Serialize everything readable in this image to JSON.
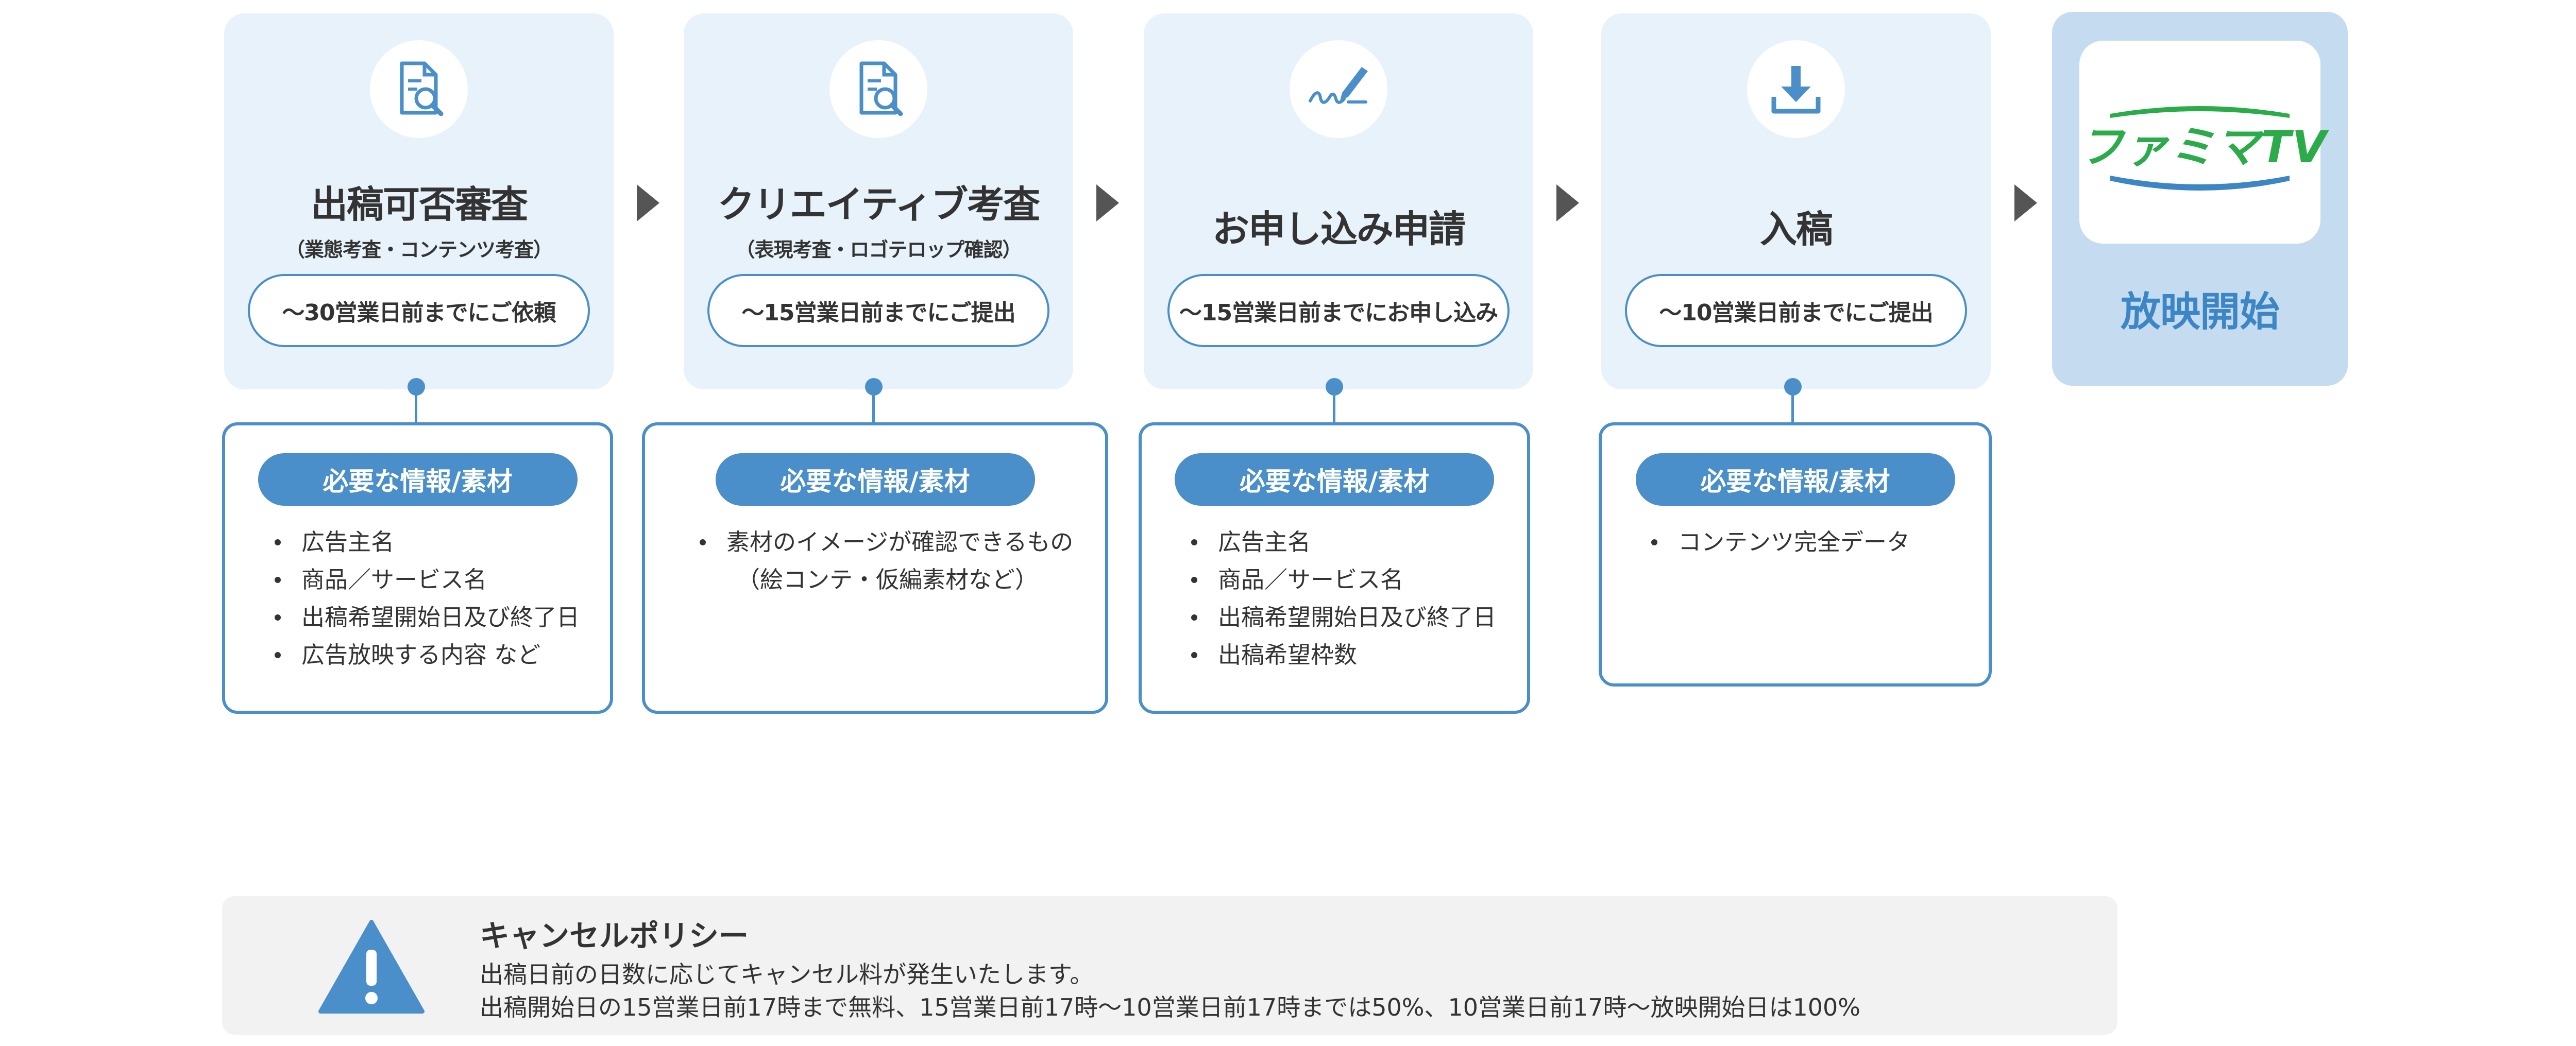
{
  "steps": [
    {
      "icon": "document-search-icon",
      "title": "出稿可否審査",
      "subtitle": "（業態考査・コンテンツ考査）",
      "deadline": "～30営業日前までにご依頼",
      "req_label": "必要な情報/素材",
      "req_items": [
        "広告主名",
        "商品／サービス名",
        "出稿希望開始日及び終了日",
        "広告放映する内容 など"
      ]
    },
    {
      "icon": "document-search-icon",
      "title": "クリエイティブ考査",
      "subtitle": "（表現考査・ロゴテロップ確認）",
      "deadline": "～15営業日前までにご提出",
      "req_label": "必要な情報/素材",
      "req_items": [
        "素材のイメージが確認できるもの"
      ],
      "req_items_sub": "（絵コンテ・仮編素材など）"
    },
    {
      "icon": "signature-icon",
      "title": "お申し込み申請",
      "deadline": "～15営業日前までにお申し込み",
      "req_label": "必要な情報/素材",
      "req_items": [
        "広告主名",
        "商品／サービス名",
        "出稿希望開始日及び終了日",
        "出稿希望枠数"
      ]
    },
    {
      "icon": "download-icon",
      "title": "入稿",
      "deadline": "～10営業日前までにご提出",
      "req_label": "必要な情報/素材",
      "req_items": [
        "コンテンツ完全データ"
      ]
    }
  ],
  "final": {
    "logo_text": "ファミマTV",
    "title": "放映開始"
  },
  "policy": {
    "icon": "warning-icon",
    "title": "キャンセルポリシー",
    "line1": "出稿日前の日数に応じてキャンセル料が発生いたします。",
    "line2": "出稿開始日の15営業日前17時まで無料、15営業日前17時～10営業日前17時までは50%、10営業日前17時～放映開始日は100%"
  },
  "colors": {
    "accent": "#4a8fc9",
    "card_bg": "#e8f2fa",
    "final_bg": "#c5dcf0",
    "logo_green": "#2bab4a",
    "logo_blue": "#3d86c6"
  }
}
